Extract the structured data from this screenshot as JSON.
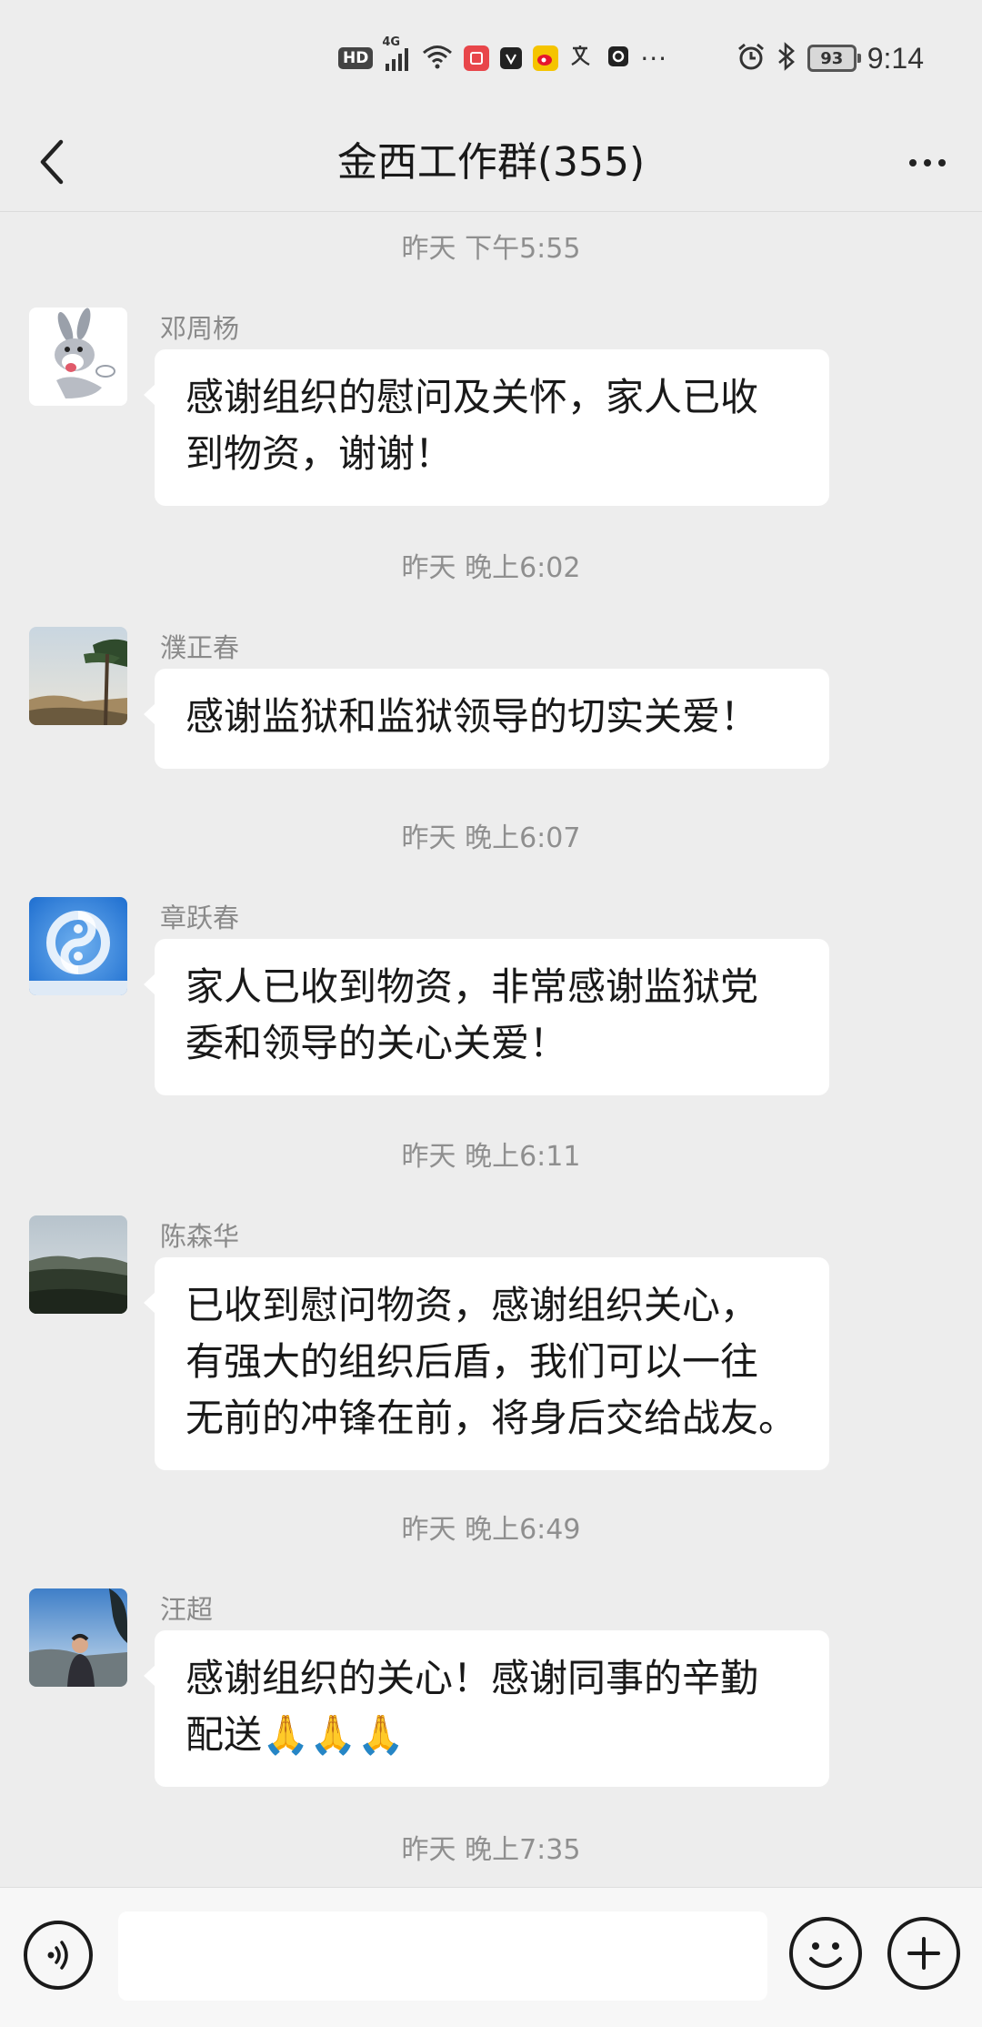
{
  "status_bar": {
    "hd": "HD",
    "network": "4G",
    "battery": "93",
    "time": "9:14",
    "more": "···",
    "icons": [
      "hd-icon",
      "signal-icon",
      "wifi-icon",
      "red-app-icon",
      "app-icon",
      "weibo-icon",
      "translate-icon",
      "record-icon",
      "alarm-icon",
      "bluetooth-icon",
      "battery-icon"
    ]
  },
  "header": {
    "title": "金西工作群(355)",
    "back_icon": "chevron-left-icon",
    "more_icon": "more-dots-icon"
  },
  "messages": [
    {
      "time": "昨天 下午5:55",
      "sender": "邓周杨",
      "text": "感谢组织的慰问及关怀，家人已收\n到物资，谢谢！",
      "avatar": "cartoon-rabbit-avatar"
    },
    {
      "time": "昨天 晚上6:02",
      "sender": "濮正春",
      "text": "感谢监狱和监狱领导的切实关爱！",
      "avatar": "pine-tree-avatar"
    },
    {
      "time": "昨天 晚上6:07",
      "sender": "章跃春",
      "text": "家人已收到物资，非常感谢监狱党\n委和领导的关心关爱！",
      "avatar": "cloud-sky-avatar"
    },
    {
      "time": "昨天 晚上6:11",
      "sender": "陈森华",
      "text": "已收到慰问物资，感谢组织关心，\n有强大的组织后盾，我们可以一往\n无前的冲锋在前，将身后交给战友。",
      "avatar": "mountain-avatar"
    },
    {
      "time": "昨天 晚上6:49",
      "sender": "汪超",
      "text": "感谢组织的关心！感谢同事的辛勤\n配送🙏🙏🙏",
      "avatar": "person-outdoor-avatar"
    }
  ],
  "last_time": "昨天 晚上7:35",
  "input_bar": {
    "voice_icon": "voice-icon",
    "input_value": "",
    "emoji_icon": "emoji-icon",
    "plus_icon": "plus-icon"
  },
  "colors": {
    "background": "#ededed",
    "bubble": "#ffffff",
    "time_text": "#8f8f8f",
    "sender_text": "#8a8a8a"
  }
}
